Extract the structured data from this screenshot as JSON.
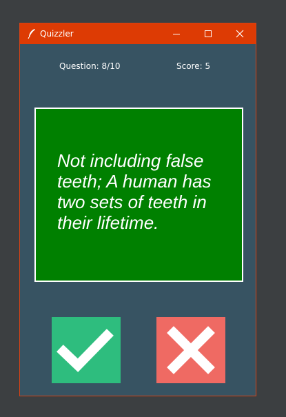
{
  "window": {
    "title": "Quizzler",
    "icons": {
      "app": "feather-icon",
      "minimize": "minimize-icon",
      "maximize": "maximize-icon",
      "close": "close-icon"
    }
  },
  "quiz": {
    "question_label": "Question: 8/10",
    "score_label": "Score: 5",
    "question_text": "Not including false teeth; A human has two sets of teeth in their lifetime.",
    "card_color": "#008000"
  },
  "buttons": {
    "true_icon": "checkmark-icon",
    "false_icon": "cross-icon",
    "true_color": "#2ebd7e",
    "false_color": "#ef6a63"
  },
  "colors": {
    "titlebar": "#dd3b04",
    "background": "#375362"
  }
}
